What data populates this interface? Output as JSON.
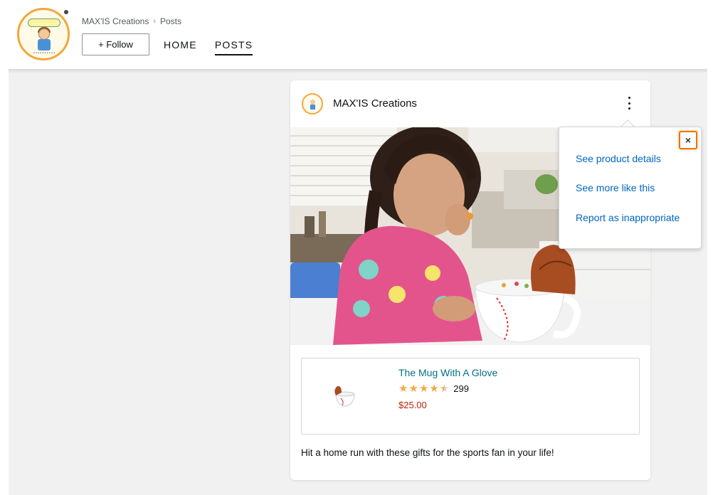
{
  "header": {
    "breadcrumb": [
      "MAX'IS Creations",
      "Posts"
    ],
    "breadcrumb_separator": "›",
    "follow_label": "+ Follow",
    "nav_tabs": [
      {
        "label": "HOME",
        "active": false
      },
      {
        "label": "POSTS",
        "active": true
      }
    ]
  },
  "post": {
    "brand_name": "MAX'IS Creations",
    "product": {
      "name": "The Mug With A Glove",
      "rating": 4.5,
      "rating_count": "299",
      "price": "$25.00"
    },
    "caption": "Hit a home run with these gifts for the sports fan in your life!"
  },
  "menu": {
    "close_label": "×",
    "items": [
      "See product details",
      "See more like this",
      "Report as inappropriate"
    ]
  },
  "colors": {
    "link": "#007185",
    "menu_link": "#0066c0",
    "price": "#b12704",
    "star": "#f3a847",
    "focus_ring": "#e77600",
    "logo_ring": "#f3a73a"
  },
  "icons": {
    "star": "★",
    "kebab": "vertical-ellipsis-icon",
    "close": "close-icon"
  }
}
